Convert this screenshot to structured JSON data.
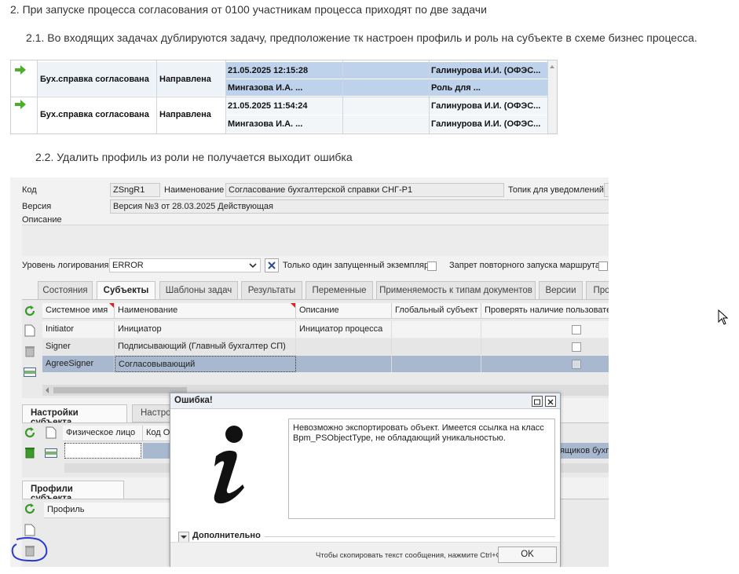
{
  "doc": {
    "p1": "2. При запуске процесса согласования от 0100 участникам процесса приходят по две задачи",
    "p2": "2.1. Во входящих задачах дублируются задачу, предположение тк настроен профиль и роль на субъекте в схеме бизнес процесса.",
    "p3": "2.2. Удалить профиль из роли не получается выходит ошибка"
  },
  "tasks": [
    {
      "name": "Бух.справка согласована",
      "status": "Направлена",
      "date": "21.05.2025 12:15:28",
      "author": "Мингазова  И.А. ...",
      "to": "Галинурова И.И. (ОФЭС...",
      "role": "Роль для ..."
    },
    {
      "name": "Бух.справка согласована",
      "status": "Направлена",
      "date": "21.05.2025 11:54:24",
      "author": "Мингазова  И.А. ...",
      "to": "Галинурова И.И. (ОФЭС...",
      "role": "Галинурова И.И. (ОФЭС..."
    }
  ],
  "erp": {
    "code_label": "Код",
    "code_value": "ZSngR1",
    "name_label": "Наименование",
    "name_value": "Согласование бухгалтерской справки СНГ-Р1",
    "topic_label": "Топик для уведомлений",
    "version_label": "Версия",
    "version_value": "Версия №3 от 28.03.2025 Действующая",
    "desc_label": "Описание",
    "log_label": "Уровень логирования",
    "log_value": "ERROR",
    "single_label": "Только один запущенный экземпляр",
    "norestart_label": "Запрет повторного запуска маршрута",
    "tabs": [
      "Состояния",
      "Субъекты",
      "Шаблоны задач",
      "Результаты",
      "Переменные",
      "Применяемость к типам документов",
      "Версии",
      "Про"
    ],
    "columns": [
      "Системное имя",
      "Наименование",
      "Описание",
      "Глобальный субъект",
      "Проверять наличие пользовател"
    ],
    "rows": [
      {
        "sys": "Initiator",
        "name": "Инициатор",
        "desc": "Инициатор процесса"
      },
      {
        "sys": "Signer",
        "name": "Подписывающий (Главный бухгалтер СП)",
        "desc": ""
      },
      {
        "sys": "AgreeSigner",
        "name": "Согласовывающий",
        "desc": ""
      }
    ],
    "subtabs": [
      "Настройки субъекта",
      "Настро"
    ],
    "sub_columns": [
      "Физическое лицо",
      "Код О"
    ],
    "sub_row_tail": "ящиков бухг",
    "profiles_tab": "Профили субъекта",
    "profiles_column": "Профиль"
  },
  "dialog": {
    "title": "Ошибка!",
    "message": "Невозможно экспортировать объект. Имеется ссылка на класс Bpm_PSObjectType, не обладающий уникальностью.",
    "details": "Дополнительно",
    "hint": "Чтобы скопировать текст сообщения, нажмите Ctrl+C",
    "ok": "OK"
  },
  "icons": [
    "arrow-right-icon",
    "refresh-icon",
    "document-icon",
    "trash-icon",
    "add-row-icon",
    "info-icon",
    "maximize-icon",
    "close-icon",
    "chevron-down-icon",
    "mouse-cursor-icon"
  ]
}
